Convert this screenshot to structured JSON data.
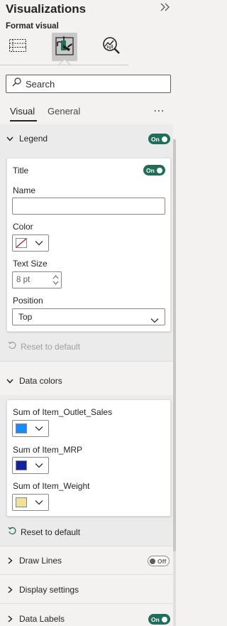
{
  "header": {
    "title": "Visualizations",
    "collapse_icon": "double-chevron-right-icon",
    "subtitle": "Format visual"
  },
  "toolbar": {
    "tools": [
      {
        "icon": "build-visual-icon",
        "selected": false
      },
      {
        "icon": "format-visual-icon",
        "selected": true
      },
      {
        "icon": "analytics-icon",
        "selected": false
      }
    ]
  },
  "search": {
    "placeholder": "Search"
  },
  "tabs": {
    "visual": "Visual",
    "general": "General",
    "more": "⋯"
  },
  "legend": {
    "label": "Legend",
    "toggle": "On",
    "title": {
      "label": "Title",
      "toggle": "On"
    },
    "name": {
      "label": "Name",
      "value": ""
    },
    "color": {
      "label": "Color",
      "value": "none"
    },
    "text_size": {
      "label": "Text Size",
      "value": "8 pt"
    },
    "position": {
      "label": "Position",
      "value": "Top"
    },
    "reset": "Reset to default"
  },
  "data_colors": {
    "label": "Data colors",
    "items": [
      {
        "label": "Sum of Item_Outlet_Sales",
        "color": "#118dff"
      },
      {
        "label": "Sum of Item_MRP",
        "color": "#12239e"
      },
      {
        "label": "Sum of Item_Weight",
        "color": "#f0e199"
      }
    ],
    "reset": "Reset to default"
  },
  "draw_lines": {
    "label": "Draw Lines",
    "toggle": "Off"
  },
  "display_settings": {
    "label": "Display settings"
  },
  "data_labels": {
    "label": "Data Labels",
    "toggle": "On"
  },
  "colors": {
    "accent": "#1e6e5a",
    "panel": "#f3f2f1",
    "expanded": "#ebebeb"
  }
}
